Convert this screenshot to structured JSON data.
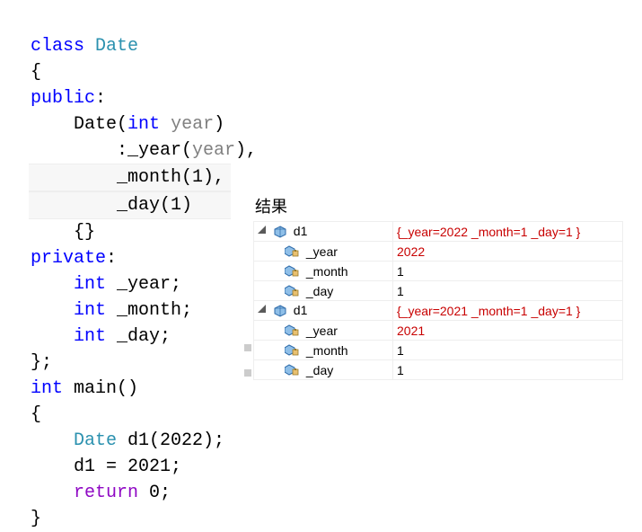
{
  "code": {
    "line1_kw_class": "class",
    "line1_type": "Date",
    "line2": "{",
    "line3_kw": "public",
    "line3_colon": ":",
    "line4_ctor": "Date",
    "line4_open": "(",
    "line4_int": "int",
    "line4_param": "year",
    "line4_close": ")",
    "line5_prefix": "        :_year(",
    "line5_param": "year",
    "line5_suffix": "),",
    "line6": "        _month(1),",
    "line7": "        _day(1)",
    "line8": "    {}",
    "line9_kw": "private",
    "line9_colon": ":",
    "line10_int": "int",
    "line10_name": " _year;",
    "line11_int": "int",
    "line11_name": " _month;",
    "line12_int": "int",
    "line12_name": " _day;",
    "line13": "};",
    "line14_int": "int",
    "line14_main": " main()",
    "line15": "{",
    "line16_type": "Date",
    "line16_rest": " d1(2022);",
    "line17": "    d1 = 2021;",
    "line18_ret": "return",
    "line18_val": " 0;",
    "line19": "}"
  },
  "results": {
    "title": "结果",
    "groups": [
      {
        "name": "d1",
        "summary": "{_year=2022 _month=1 _day=1 }",
        "summary_red": true,
        "fields": [
          {
            "name": "_year",
            "value": "2022",
            "red": true
          },
          {
            "name": "_month",
            "value": "1",
            "red": false
          },
          {
            "name": "_day",
            "value": "1",
            "red": false
          }
        ]
      },
      {
        "name": "d1",
        "summary": "{_year=2021 _month=1 _day=1 }",
        "summary_red": true,
        "fields": [
          {
            "name": "_year",
            "value": "2021",
            "red": true
          },
          {
            "name": "_month",
            "value": "1",
            "red": false
          },
          {
            "name": "_day",
            "value": "1",
            "red": false
          }
        ]
      }
    ]
  }
}
